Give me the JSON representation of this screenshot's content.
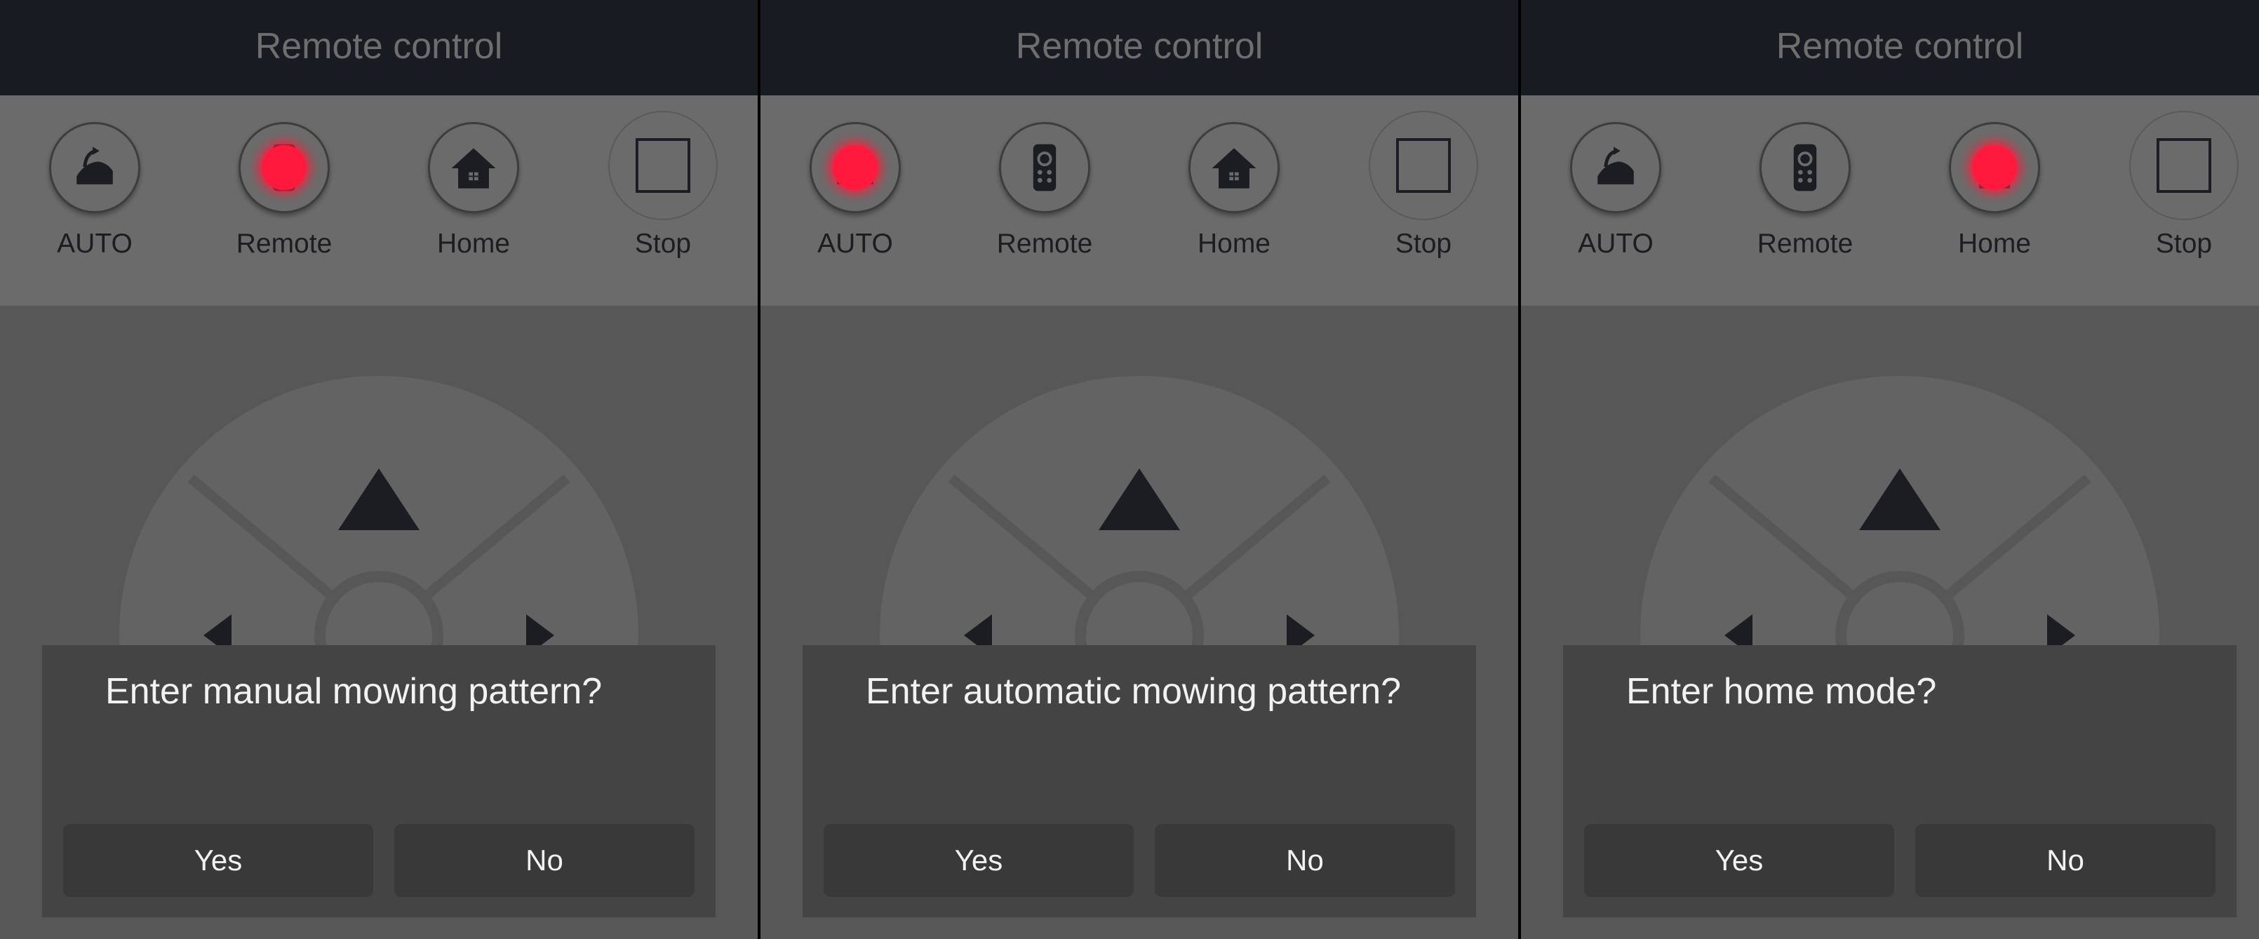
{
  "screens": [
    {
      "title": "Remote control",
      "modes": [
        {
          "label": "AUTO",
          "icon": "mower-icon",
          "active": false
        },
        {
          "label": "Remote",
          "icon": "remote-icon",
          "active": true
        },
        {
          "label": "Home",
          "icon": "home-icon",
          "active": false
        },
        {
          "label": "Stop",
          "icon": "stop-icon",
          "active": false
        }
      ],
      "dialog": {
        "message": "Enter manual mowing pattern?",
        "yes_label": "Yes",
        "no_label": "No"
      }
    },
    {
      "title": "Remote control",
      "modes": [
        {
          "label": "AUTO",
          "icon": "mower-icon",
          "active": true
        },
        {
          "label": "Remote",
          "icon": "remote-icon",
          "active": false
        },
        {
          "label": "Home",
          "icon": "home-icon",
          "active": false
        },
        {
          "label": "Stop",
          "icon": "stop-icon",
          "active": false
        }
      ],
      "dialog": {
        "message": "Enter automatic mowing pattern?",
        "yes_label": "Yes",
        "no_label": "No"
      }
    },
    {
      "title": "Remote control",
      "modes": [
        {
          "label": "AUTO",
          "icon": "mower-icon",
          "active": false
        },
        {
          "label": "Remote",
          "icon": "remote-icon",
          "active": false
        },
        {
          "label": "Home",
          "icon": "home-icon",
          "active": true
        },
        {
          "label": "Stop",
          "icon": "stop-icon",
          "active": false
        }
      ],
      "dialog": {
        "message": "Enter home mode?",
        "yes_label": "Yes",
        "no_label": "No"
      }
    }
  ],
  "colors": {
    "active_indicator": "#ff1a3d",
    "top_bar": "#181c22",
    "mode_bar": "#6b6b6b",
    "dialog": "#444444"
  }
}
